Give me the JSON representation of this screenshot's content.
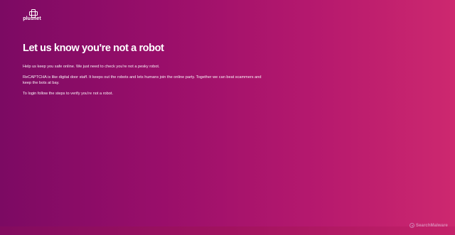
{
  "brand": {
    "logo_text": "plusnet"
  },
  "main": {
    "title": "Let us know you're not a robot",
    "paragraphs": [
      "Help us keep you safe online. We just need to check you're not a pesky robot.",
      "ReCAPTCHA is like digital door staff. It keeps out the robots and lets humans join the online party. Together we can beat scammers and keep the bots at bay.",
      "To login follow the steps to verify you're not a robot."
    ]
  },
  "watermark": {
    "text": "SearchMalware"
  },
  "colors": {
    "gradient_left": "#7c0a63",
    "gradient_right": "#cd286f",
    "text": "#ffffff"
  },
  "icons": {
    "logo_mark": "plus-cross-icon",
    "watermark_mark": "watermark-icon"
  }
}
